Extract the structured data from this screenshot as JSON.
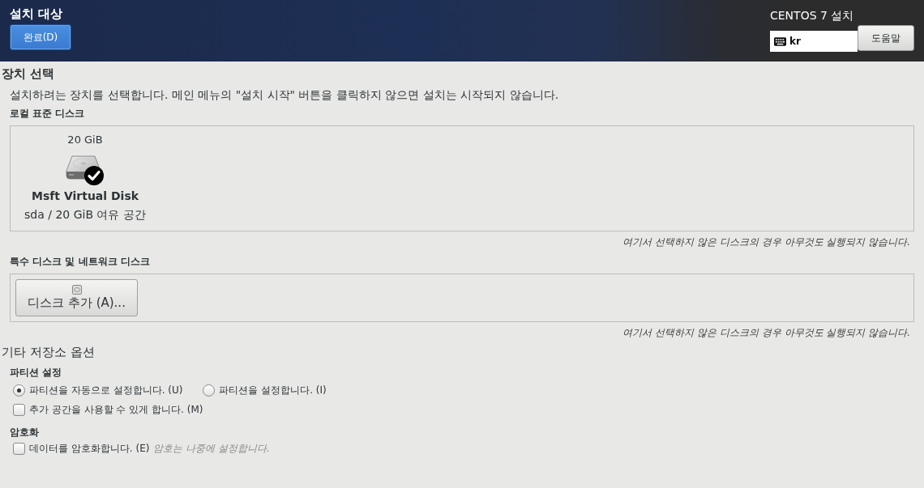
{
  "header": {
    "title": "설치 대상",
    "done_button": "완료(D)",
    "product": "CENTOS 7 설치",
    "keyboard": {
      "value": "kr"
    },
    "help_button": "도움말"
  },
  "device_selection": {
    "title": "장치 선택",
    "description": "설치하려는 장치를 선택합니다. 메인 메뉴의 \"설치 시작\" 버튼을 클릭하지 않으면 설치는 시작되지 않습니다.",
    "local_disks": {
      "title": "로컬 표준 디스크",
      "disks": [
        {
          "size": "20 GiB",
          "name": "Msft Virtual Disk",
          "detail": "sda / 20 GiB 여유 공간",
          "selected": true
        }
      ],
      "note": "여기서 선택하지 않은 디스크의 경우 아무것도 실행되지 않습니다."
    },
    "special_disks": {
      "title": "특수 디스크 및 네트워크 디스크",
      "add_button": "디스크 추가 (A)...",
      "note": "여기서 선택하지 않은 디스크의 경우 아무것도 실행되지 않습니다."
    }
  },
  "other_options": {
    "title": "기타 저장소 옵션",
    "partitioning": {
      "title": "파티션 설정",
      "modes": [
        {
          "label": "파티션을 자동으로 설정합니다. (U)",
          "selected": true
        },
        {
          "label": "파티션을 설정합니다. (I)",
          "selected": false
        }
      ],
      "reclaim": {
        "label": "추가 공간을 사용할 수 있게 합니다. (M)",
        "checked": false
      }
    },
    "encryption": {
      "title": "암호화",
      "encrypt": {
        "label": "데이터를 암호화합니다. (E)",
        "checked": false,
        "hint": "암호는 나중에 설정합니다."
      }
    }
  }
}
